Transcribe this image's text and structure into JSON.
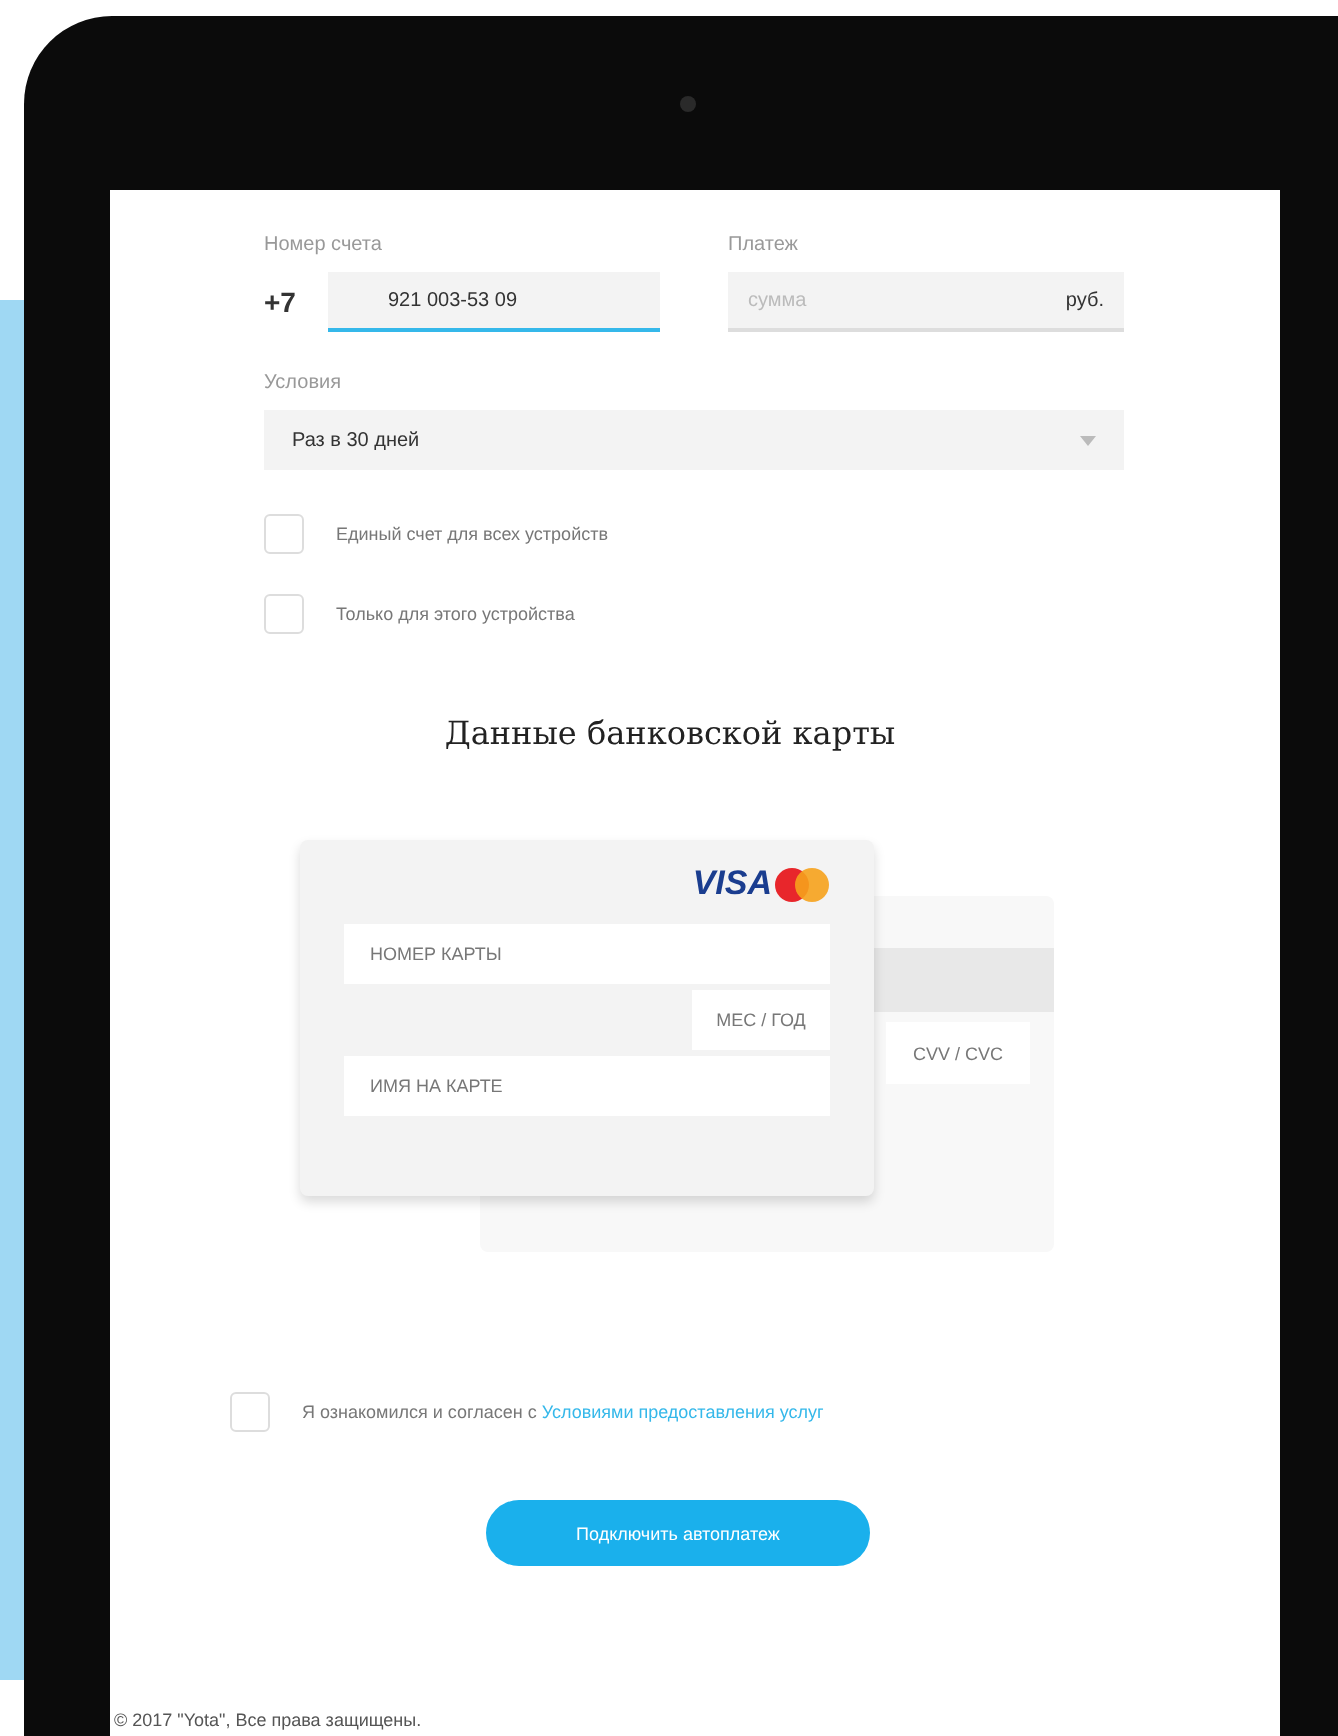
{
  "account": {
    "label": "Номер счета",
    "prefix": "+7",
    "value": "921 003-53 09",
    "active": true
  },
  "payment": {
    "label": "Платеж",
    "placeholder": "сумма",
    "unit": "руб.",
    "active": false
  },
  "conditions": {
    "label": "Условия",
    "value": "Раз в 30 дней"
  },
  "options": [
    {
      "label": "Единый счет для всех устройств",
      "checked": false
    },
    {
      "label": "Только для этого устройства",
      "checked": false
    }
  ],
  "card_section": {
    "title": "Данные банковской карты",
    "logo": "VISA",
    "number_placeholder": "НОМЕР КАРТЫ",
    "expiry_placeholder": "МЕС / ГОД",
    "name_placeholder": "ИМЯ НА КАРТЕ",
    "cvv_placeholder": "CVV / CVC"
  },
  "agreement": {
    "text": "Я ознакомился и согласен с",
    "link": "Условиями предоставления услуг",
    "checked": false
  },
  "submit": "Подключить автоплатеж",
  "footer": "© 2017 \"Yota\", Все права защищены."
}
